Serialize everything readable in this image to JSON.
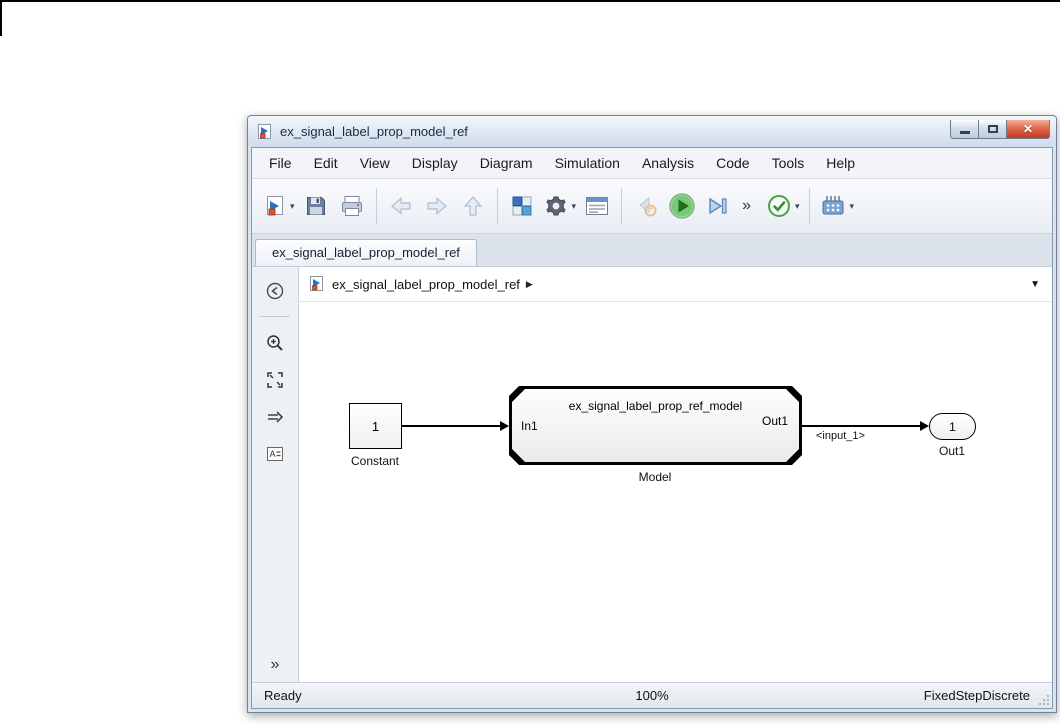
{
  "window": {
    "title": "ex_signal_label_prop_model_ref"
  },
  "menu": {
    "items": [
      "File",
      "Edit",
      "View",
      "Display",
      "Diagram",
      "Simulation",
      "Analysis",
      "Code",
      "Tools",
      "Help"
    ]
  },
  "toolbar": {
    "buttons": [
      "new-model",
      "save",
      "print",
      "navigate-back",
      "navigate-forward",
      "navigate-up",
      "library-browser",
      "model-settings",
      "model-explorer",
      "step-back",
      "run",
      "step-forward",
      "overflow",
      "check-code",
      "deploy"
    ],
    "overflow_label": "»"
  },
  "tabs": {
    "active_label": "ex_signal_label_prop_model_ref"
  },
  "breadcrumb": {
    "model_label": "ex_signal_label_prop_model_ref"
  },
  "palette": {
    "buttons": [
      "hide-browser",
      "zoom",
      "fit-to-view",
      "signal-routing",
      "annotation"
    ],
    "overflow_label": "»"
  },
  "canvas": {
    "constant_value": "1",
    "constant_label": "Constant",
    "model_title": "ex_signal_label_prop_ref_model",
    "model_in_port": "In1",
    "model_out_port": "Out1",
    "model_label": "Model",
    "signal_label": "<input_1>",
    "outport_value": "1",
    "outport_label": "Out1"
  },
  "statusbar": {
    "status": "Ready",
    "zoom": "100%",
    "solver": "FixedStepDiscrete"
  },
  "colors": {
    "run_green": "#3d9c3d",
    "close_red": "#c23a1f",
    "simulink_blue": "#2f6fc0",
    "simulink_orange": "#e0502a",
    "titlebar_gradient_top": "#f4f8fc",
    "titlebar_gradient_bottom": "#cfdcec"
  }
}
